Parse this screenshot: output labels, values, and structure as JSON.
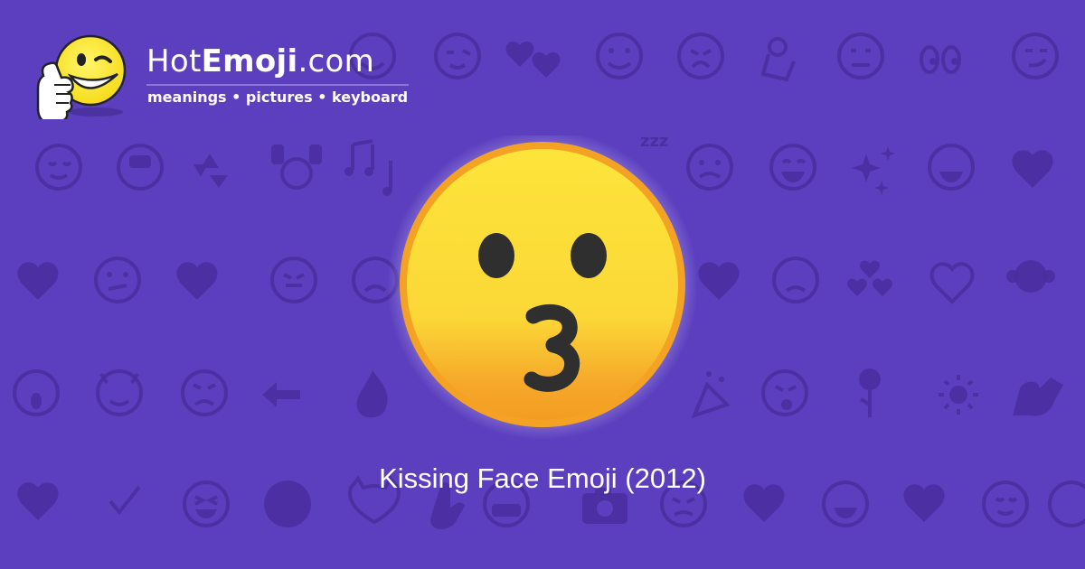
{
  "brand": {
    "name_prefix": "Hot",
    "name_bold": "Emoji",
    "name_suffix": ".com",
    "tagline": "meanings • pictures • keyboard",
    "logo_icon": "thumbs-up-winking-face-icon"
  },
  "main": {
    "emoji_icon": "kissing-face-icon",
    "caption": "Kissing Face Emoji (2012)"
  },
  "colors": {
    "background": "#5b3fbf",
    "pattern": "#4a2fa0",
    "emoji_yellow": "#fbd837",
    "emoji_orange": "#f2a024",
    "feature_dark": "#2f2f2f"
  },
  "background_pattern": {
    "icons": [
      "grinning-face-icon",
      "winking-face-icon",
      "heart-icon",
      "two-hearts-icon",
      "ok-hand-icon",
      "eyes-icon",
      "smirking-face-icon",
      "musical-notes-icon",
      "recycle-icon",
      "sparkles-icon",
      "broken-heart-icon",
      "monkey-icon",
      "fire-icon",
      "left-arrow-icon",
      "rose-icon",
      "sun-icon",
      "flexed-biceps-icon",
      "check-mark-icon",
      "camera-icon",
      "party-popper-icon",
      "zzz-icon"
    ]
  }
}
